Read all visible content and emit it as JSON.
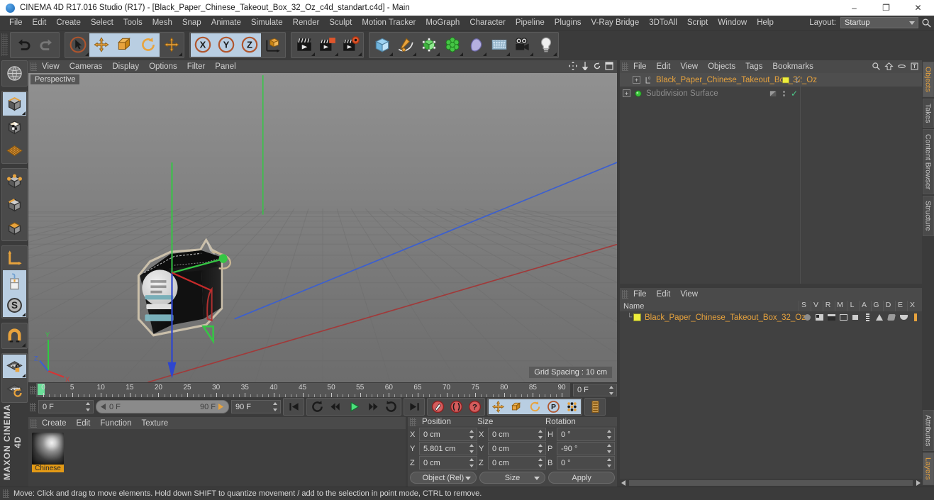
{
  "window": {
    "title": "CINEMA 4D R17.016 Studio (R17) - [Black_Paper_Chinese_Takeout_Box_32_Oz_c4d_standart.c4d] - Main",
    "minimize": "–",
    "maximize": "❐",
    "close": "✕"
  },
  "menubar": {
    "items": [
      "File",
      "Edit",
      "Create",
      "Select",
      "Tools",
      "Mesh",
      "Snap",
      "Animate",
      "Simulate",
      "Render",
      "Sculpt",
      "Motion Tracker",
      "MoGraph",
      "Character",
      "Pipeline",
      "Plugins",
      "V-Ray Bridge",
      "3DToAll",
      "Script",
      "Window",
      "Help"
    ],
    "layout_label": "Layout:",
    "layout_value": "Startup"
  },
  "toolbar": {
    "groups": [
      {
        "name": "undo-redo",
        "buttons": [
          {
            "name": "undo-button",
            "icon": "undo-icon"
          },
          {
            "name": "redo-button",
            "icon": "redo-icon"
          }
        ]
      },
      {
        "name": "transform-tools",
        "buttons": [
          {
            "name": "live-selection-button",
            "icon": "cursor-select-icon"
          },
          {
            "name": "move-tool-button",
            "icon": "move-icon"
          },
          {
            "name": "scale-tool-button",
            "icon": "scale-icon"
          },
          {
            "name": "rotate-tool-button",
            "icon": "rotate-icon"
          },
          {
            "name": "pan-tool-button",
            "icon": "move-axis-icon"
          }
        ]
      },
      {
        "name": "axis-locks",
        "buttons": [
          {
            "name": "x-axis-lock-button",
            "icon": "x-axis-icon"
          },
          {
            "name": "y-axis-lock-button",
            "icon": "y-axis-icon"
          },
          {
            "name": "z-axis-lock-button",
            "icon": "z-axis-icon"
          },
          {
            "name": "world-object-coordinate-button",
            "icon": "coordinate-system-icon"
          }
        ]
      },
      {
        "name": "render-tools",
        "buttons": [
          {
            "name": "render-view-button",
            "icon": "clapperboard-icon"
          },
          {
            "name": "render-to-picture-viewer-button",
            "icon": "clapperboard-render-icon"
          },
          {
            "name": "render-settings-button",
            "icon": "render-settings-icon"
          }
        ]
      },
      {
        "name": "create-objects",
        "buttons": [
          {
            "name": "add-cube-button",
            "icon": "cube-icon"
          },
          {
            "name": "add-spline-button",
            "icon": "pen-spline-icon"
          },
          {
            "name": "add-generator-button",
            "icon": "green-cube-generator-icon"
          },
          {
            "name": "add-mograph-button",
            "icon": "cloner-icon"
          },
          {
            "name": "add-deformer-button",
            "icon": "bend-deformer-icon"
          },
          {
            "name": "add-environment-button",
            "icon": "floor-environment-icon"
          },
          {
            "name": "add-camera-button",
            "icon": "camera-icon"
          },
          {
            "name": "add-light-button",
            "icon": "light-bulb-icon"
          }
        ]
      }
    ]
  },
  "lefttools": {
    "groups": [
      {
        "name": "deformed-editing",
        "buttons": [
          {
            "name": "make-editable-button",
            "icon": "globe-wire-icon"
          }
        ]
      },
      {
        "name": "mode-group-1",
        "buttons": [
          {
            "name": "model-mode-button",
            "icon": "model-cube-icon"
          },
          {
            "name": "texture-mode-button",
            "icon": "texture-cube-icon"
          },
          {
            "name": "workplane-mode-button",
            "icon": "workplane-icon"
          }
        ]
      },
      {
        "name": "component-modes",
        "buttons": [
          {
            "name": "points-mode-button",
            "icon": "points-cube-icon"
          },
          {
            "name": "edges-mode-button",
            "icon": "edges-cube-icon"
          },
          {
            "name": "polygons-mode-button",
            "icon": "polygons-cube-icon"
          }
        ]
      },
      {
        "name": "axis-group",
        "buttons": [
          {
            "name": "enable-axis-modification-button",
            "icon": "axis-icon"
          },
          {
            "name": "enable-snapping-button",
            "icon": "mouse-icon"
          },
          {
            "name": "viewport-solo-button",
            "icon": "s-circle-icon"
          }
        ]
      },
      {
        "name": "magnet-group",
        "buttons": [
          {
            "name": "magnet-tool-button",
            "icon": "magnet-icon"
          }
        ]
      },
      {
        "name": "lock-group",
        "buttons": [
          {
            "name": "lock-workplane-button",
            "icon": "workplane-lock-icon"
          },
          {
            "name": "planar-workplane-button",
            "icon": "workplane-rotate-icon"
          }
        ]
      }
    ],
    "brand_line_1": "MAXON",
    "brand_line_2": "CINEMA 4D"
  },
  "viewport": {
    "menu": [
      "View",
      "Cameras",
      "Display",
      "Options",
      "Filter",
      "Panel"
    ],
    "perspective_label": "Perspective",
    "grid_spacing": "Grid Spacing : 10 cm",
    "corner_icons": [
      "pan-view-icon",
      "dolly-view-icon",
      "rotate-view-icon",
      "maximize-view-icon"
    ]
  },
  "timeline": {
    "ticks": [
      0,
      5,
      10,
      15,
      20,
      25,
      30,
      35,
      40,
      45,
      50,
      55,
      60,
      65,
      70,
      75,
      80,
      85,
      90
    ],
    "current_frame_field": "0 F",
    "start_frame": "0 F",
    "range_start": "0 F",
    "range_end": "90 F",
    "end_frame": "90 F",
    "transport": [
      {
        "name": "go-to-start-button",
        "icon": "skip-start-icon"
      },
      {
        "name": "play-backwards-button",
        "icon": "loop-back-icon"
      },
      {
        "name": "step-back-button",
        "icon": "step-back-icon"
      },
      {
        "name": "play-button",
        "icon": "play-icon"
      },
      {
        "name": "step-forward-button",
        "icon": "step-forward-icon"
      },
      {
        "name": "play-forwards-button",
        "icon": "loop-forward-icon"
      },
      {
        "name": "go-to-end-button",
        "icon": "skip-end-icon"
      }
    ],
    "record_buttons": [
      {
        "name": "record-active-objects-button",
        "icon": "record-key-icon"
      },
      {
        "name": "autokeying-button",
        "icon": "autokey-icon"
      },
      {
        "name": "keyframe-selection-button",
        "icon": "question-key-icon"
      }
    ],
    "key_filter_buttons": [
      {
        "name": "position-key-button",
        "icon": "move-key-icon"
      },
      {
        "name": "scale-key-button",
        "icon": "scale-key-icon"
      },
      {
        "name": "rotation-key-button",
        "icon": "rotate-key-icon"
      },
      {
        "name": "parameter-key-button",
        "icon": "param-key-icon"
      },
      {
        "name": "pla-key-button",
        "icon": "pla-key-icon"
      },
      {
        "name": "timeline-button",
        "icon": "timeline-strip-icon"
      }
    ]
  },
  "material_manager": {
    "menu": [
      "Create",
      "Edit",
      "Function",
      "Texture"
    ],
    "materials": [
      {
        "name": "Chinese"
      }
    ]
  },
  "coordinates": {
    "headers": [
      "Position",
      "Size",
      "Rotation"
    ],
    "position": {
      "labels": [
        "X",
        "Y",
        "Z"
      ],
      "values": [
        "0 cm",
        "5.801 cm",
        "0 cm"
      ]
    },
    "size": {
      "labels": [
        "X",
        "Y",
        "Z"
      ],
      "values": [
        "0 cm",
        "0 cm",
        "0 cm"
      ]
    },
    "rotation": {
      "labels": [
        "H",
        "P",
        "B"
      ],
      "values": [
        "0 °",
        "-90 °",
        "0 °"
      ]
    },
    "mode_left": "Object (Rel)",
    "mode_mid": "Size",
    "apply": "Apply"
  },
  "object_manager": {
    "menu": [
      "File",
      "Edit",
      "View",
      "Objects",
      "Tags",
      "Bookmarks"
    ],
    "icons": [
      "search-icon",
      "home-icon",
      "dash-icon",
      "fit-icon"
    ],
    "rows": [
      {
        "label": "Subdivision Surface",
        "icon": "subdivision-surface-icon",
        "indent": 0,
        "tag": "display-tag",
        "check": "✓"
      },
      {
        "label": "Black_Paper_Chinese_Takeout_Box_32_Oz",
        "icon": "polygon-object-icon",
        "indent": 1,
        "tag": "material-tag"
      }
    ]
  },
  "attribute_manager": {
    "menu": [
      "File",
      "Edit",
      "View"
    ],
    "name_header": "Name",
    "columns": [
      "S",
      "V",
      "R",
      "M",
      "L",
      "A",
      "G",
      "D",
      "E",
      "X"
    ],
    "rows": [
      {
        "label": "Black_Paper_Chinese_Takeout_Box_32_Oz"
      }
    ]
  },
  "vertical_tabs": {
    "top": [
      "Objects",
      "Takes",
      "Content Browser",
      "Structure"
    ],
    "bottom": [
      "Attributes",
      "Layers"
    ],
    "active_top": "Objects",
    "active_bottom": "Layers"
  },
  "statusbar": {
    "message": "Move: Click and drag to move elements. Hold down SHIFT to quantize movement / add to the selection in point mode, CTRL to remove."
  },
  "colors": {
    "accent_orange": "#e8a33d",
    "selection_blue": "#b9cee2",
    "panel_bg": "#454545",
    "app_bg": "#3b3b3b",
    "green_axis": "#2ecc40",
    "red_axis": "#d63434",
    "blue_axis": "#3b5fd0"
  }
}
